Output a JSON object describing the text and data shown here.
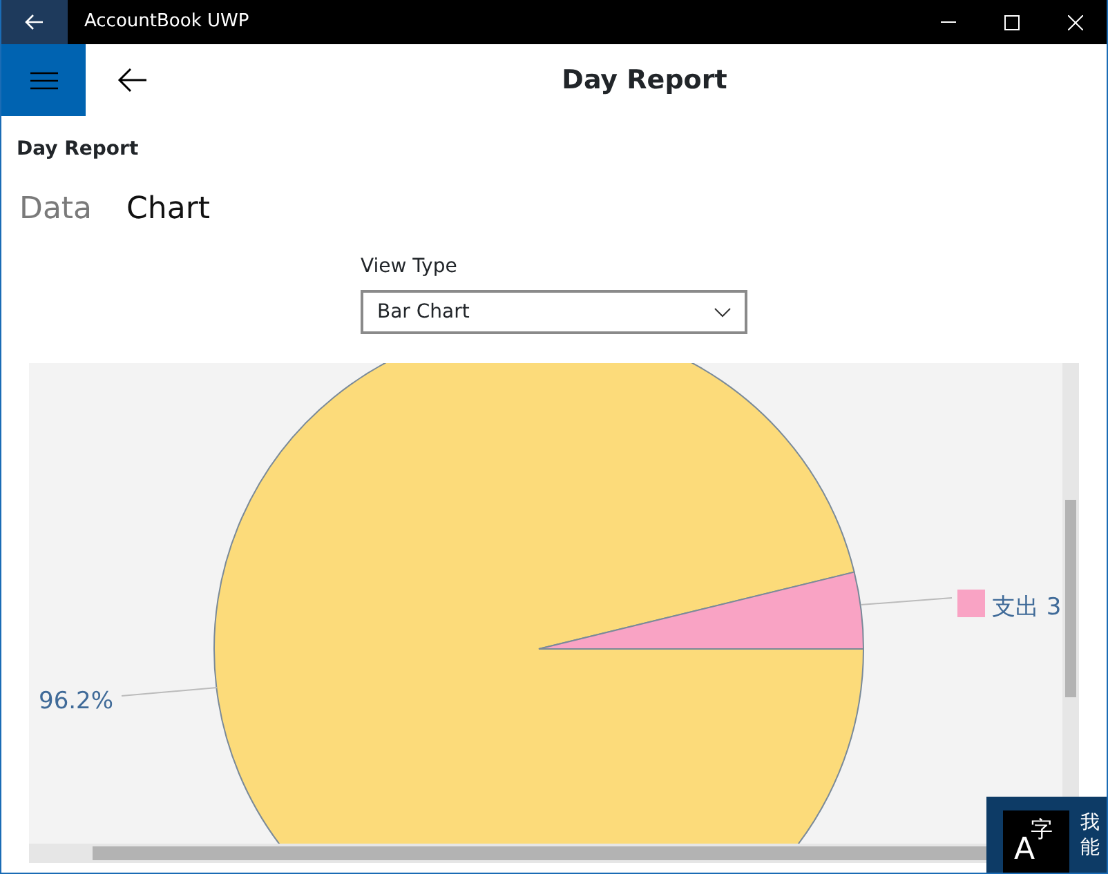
{
  "window": {
    "title": "AccountBook UWP"
  },
  "header": {
    "title": "Day Report"
  },
  "page_title": "Day Report",
  "tabs": [
    {
      "label": "Data",
      "selected": false
    },
    {
      "label": "Chart",
      "selected": true
    }
  ],
  "view_type": {
    "label": "View Type",
    "value": "Bar Chart"
  },
  "pie_chart": {
    "percent_label": "96.2%",
    "legend_label": "支出 3"
  },
  "ime_toast": {
    "icon_letter": "A",
    "icon_char": "字",
    "lines": [
      "我",
      "能"
    ]
  }
}
